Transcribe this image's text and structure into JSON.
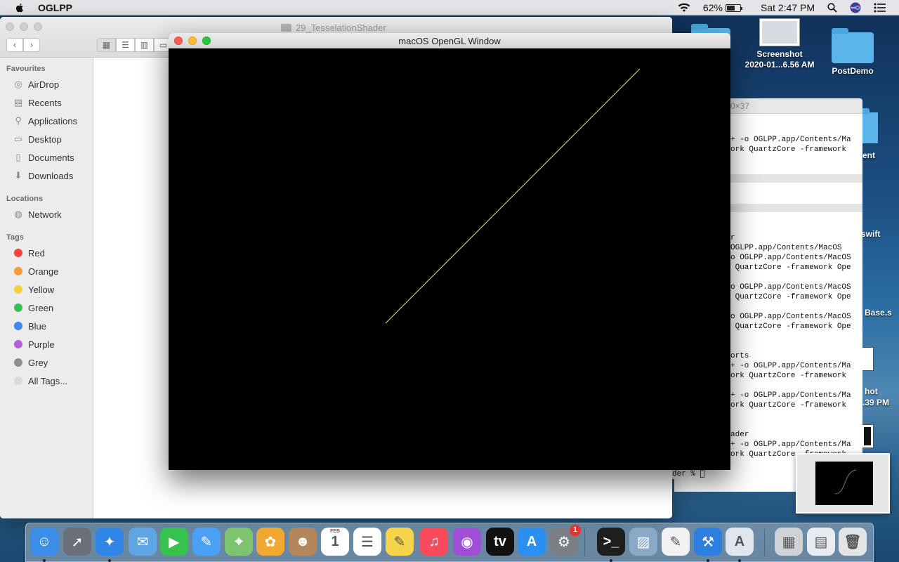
{
  "menubar": {
    "app_name": "OGLPP",
    "battery_percent": "62%",
    "battery_level": 0.62,
    "clock": "Sat 2:47 PM"
  },
  "desktop": {
    "icons": [
      {
        "name": "Screenshot",
        "sub": "2020-01...6.56 AM"
      },
      {
        "name": "PostDemo"
      }
    ],
    "clipped_labels": [
      "ent",
      "swift",
      "Base.s",
      "hot",
      ".39 PM"
    ]
  },
  "terminal": {
    "title_fragment": "0×37",
    "lines": [
      "+ -o OGLPP.app/Contents/Ma",
      "ork QuartzCore -framework",
      "r",
      "OGLPP.app/Contents/MacOS",
      "o OGLPP.app/Contents/MacOS",
      " QuartzCore -framework Ope",
      "o OGLPP.app/Contents/MacOS",
      " QuartzCore -framework Ope",
      "o OGLPP.app/Contents/MacOS",
      " QuartzCore -framework Ope",
      "orts",
      "+ -o OGLPP.app/Contents/Ma",
      "ork QuartzCore -framework",
      "+ -o OGLPP.app/Contents/Ma",
      "ork QuartzCore -framework",
      "ader",
      "+ -o OGLPP.app/Contents/Ma",
      "ork QuartzCore -framework",
      "der % "
    ]
  },
  "finder": {
    "title": "29_TesselationShader",
    "back_glyph": "‹",
    "forward_glyph": "›",
    "sections": {
      "favourites": "Favourites",
      "locations": "Locations",
      "tags": "Tags"
    },
    "favourites": [
      {
        "label": "AirDrop",
        "icon": "airdrop-icon",
        "glyph": "◎"
      },
      {
        "label": "Recents",
        "icon": "recents-icon",
        "glyph": "▤"
      },
      {
        "label": "Applications",
        "icon": "applications-icon",
        "glyph": "⚲"
      },
      {
        "label": "Desktop",
        "icon": "desktop-icon",
        "glyph": "▭"
      },
      {
        "label": "Documents",
        "icon": "documents-icon",
        "glyph": "▯"
      },
      {
        "label": "Downloads",
        "icon": "downloads-icon",
        "glyph": "⬇"
      }
    ],
    "locations": [
      {
        "label": "Network",
        "icon": "network-icon",
        "glyph": "◍"
      }
    ],
    "tags": [
      {
        "label": "Red",
        "color": "#f0453c"
      },
      {
        "label": "Orange",
        "color": "#f79a35"
      },
      {
        "label": "Yellow",
        "color": "#f8cf3c"
      },
      {
        "label": "Green",
        "color": "#37c152"
      },
      {
        "label": "Blue",
        "color": "#3a88f0"
      },
      {
        "label": "Purple",
        "color": "#b560d6"
      },
      {
        "label": "Grey",
        "color": "#8e8e93"
      },
      {
        "label": "All Tags...",
        "color": "#d9d9d9"
      }
    ]
  },
  "gl_window": {
    "title": "macOS OpenGL Window",
    "background": "#000000",
    "line_color": "#e8e85a"
  },
  "dock": {
    "apps": [
      {
        "name": "finder-icon",
        "color": "#3b8ee8",
        "glyph": "☺",
        "running": true
      },
      {
        "name": "launchpad-icon",
        "color": "#6b6f78",
        "glyph": "➚",
        "running": false
      },
      {
        "name": "safari-icon",
        "color": "#2f86e6",
        "glyph": "✦",
        "running": true
      },
      {
        "name": "mail-icon",
        "color": "#5fa5e4",
        "glyph": "✉",
        "running": false
      },
      {
        "name": "facetime-icon",
        "color": "#36c24d",
        "glyph": "▶",
        "running": false
      },
      {
        "name": "messages-icon",
        "color": "#4ba0f4",
        "glyph": "✎",
        "running": false
      },
      {
        "name": "maps-icon",
        "color": "#7ec46e",
        "glyph": "⌖",
        "running": false
      },
      {
        "name": "photos-icon",
        "color": "#f0a830",
        "glyph": "✿",
        "running": false
      },
      {
        "name": "contacts-icon",
        "color": "#b4865c",
        "glyph": "☻",
        "running": false
      },
      {
        "name": "calendar-icon",
        "color": "#ffffff",
        "glyph": "1",
        "label": "FEB",
        "running": false
      },
      {
        "name": "reminders-icon",
        "color": "#ffffff",
        "glyph": "☰",
        "running": false
      },
      {
        "name": "notes-icon",
        "color": "#f5d34a",
        "glyph": "✎",
        "running": false
      },
      {
        "name": "music-icon",
        "color": "#fa4a5c",
        "glyph": "♫",
        "running": false
      },
      {
        "name": "podcasts-icon",
        "color": "#9e4fd6",
        "glyph": "◉",
        "running": false
      },
      {
        "name": "appletv-icon",
        "color": "#111111",
        "glyph": "tv",
        "running": false
      },
      {
        "name": "appstore-icon",
        "color": "#2a8ff0",
        "glyph": "A",
        "running": false
      },
      {
        "name": "system-preferences-icon",
        "color": "#7b7e84",
        "glyph": "⚙",
        "badge": "1",
        "running": false
      },
      {
        "name": "terminal-icon",
        "color": "#1e1e1e",
        "glyph": ">_",
        "running": true
      },
      {
        "name": "preview-icon",
        "color": "#8aa9c6",
        "glyph": "▨",
        "running": false
      },
      {
        "name": "textedit-icon",
        "color": "#f2f2f2",
        "glyph": "✎",
        "running": false
      },
      {
        "name": "xcode-icon",
        "color": "#2d7fe0",
        "glyph": "⚒",
        "running": true
      },
      {
        "name": "instruments-icon",
        "color": "#e0e6ee",
        "glyph": "A",
        "running": true
      },
      {
        "name": "downloads-stack-icon",
        "color": "#cfd3d8",
        "glyph": "▦",
        "running": false
      },
      {
        "name": "documents-stack-icon",
        "color": "#e8ecf2",
        "glyph": "▤",
        "running": false
      },
      {
        "name": "trash-icon",
        "color": "#e2e4e8",
        "glyph": "🗑",
        "running": false
      }
    ]
  }
}
